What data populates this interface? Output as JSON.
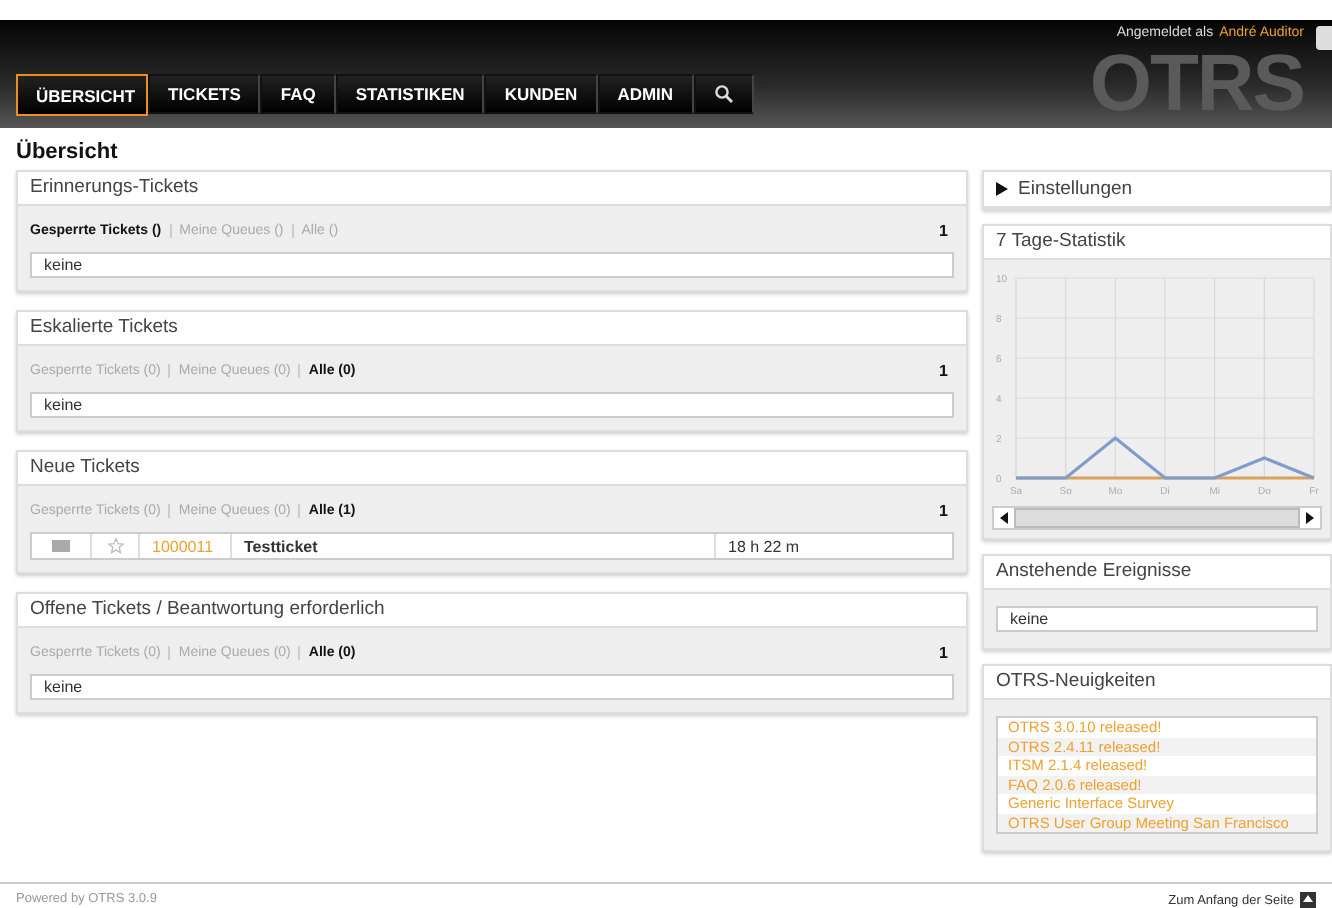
{
  "header": {
    "logo": "OTRS",
    "login_label": "Angemeldet als",
    "user": "André Auditor"
  },
  "nav": [
    {
      "label": "ÜBERSICHT",
      "selected": true
    },
    {
      "label": "TICKETS",
      "selected": false
    },
    {
      "label": "FAQ",
      "selected": false
    },
    {
      "label": "STATISTIKEN",
      "selected": false
    },
    {
      "label": "KUNDEN",
      "selected": false
    },
    {
      "label": "ADMIN",
      "selected": false
    }
  ],
  "page_title": "Übersicht",
  "widgets": [
    {
      "title": "Erinnerungs-Tickets",
      "filters": [
        {
          "label": "Gesperrte Tickets ()",
          "selected": true
        },
        {
          "label": "Meine Queues ()",
          "selected": false
        },
        {
          "label": "Alle ()",
          "selected": false
        }
      ],
      "page": "1",
      "empty": "keine"
    },
    {
      "title": "Eskalierte Tickets",
      "filters": [
        {
          "label": "Gesperrte Tickets (0)",
          "selected": false
        },
        {
          "label": "Meine Queues (0)",
          "selected": false
        },
        {
          "label": "Alle (0)",
          "selected": true
        }
      ],
      "page": "1",
      "empty": "keine"
    },
    {
      "title": "Neue Tickets",
      "filters": [
        {
          "label": "Gesperrte Tickets (0)",
          "selected": false
        },
        {
          "label": "Meine Queues (0)",
          "selected": false
        },
        {
          "label": "Alle (1)",
          "selected": true
        }
      ],
      "page": "1",
      "rows": [
        {
          "number": "1000011",
          "title": "Testticket",
          "age": "18 h 22 m"
        }
      ]
    },
    {
      "title": "Offene Tickets / Beantwortung erforderlich",
      "filters": [
        {
          "label": "Gesperrte Tickets (0)",
          "selected": false
        },
        {
          "label": "Meine Queues (0)",
          "selected": false
        },
        {
          "label": "Alle (0)",
          "selected": true
        }
      ],
      "page": "1",
      "empty": "keine"
    }
  ],
  "settings": {
    "title": "Einstellungen",
    "expanded": false
  },
  "stats": {
    "title": "7 Tage-Statistik",
    "chart_data": {
      "type": "line",
      "categories": [
        "Sa",
        "So",
        "Mo",
        "Di",
        "Mi",
        "Do",
        "Fr"
      ],
      "ylim": [
        0,
        10
      ],
      "grid": true,
      "yticks": [
        0,
        2,
        4,
        6,
        8,
        10
      ],
      "series": [
        {
          "color": "#d9a25a",
          "values": [
            0,
            0,
            0,
            0,
            0,
            0,
            0
          ]
        },
        {
          "color": "#7e9ccc",
          "values": [
            0,
            0,
            2,
            0,
            0,
            1,
            0
          ]
        }
      ]
    }
  },
  "events": {
    "title": "Anstehende Ereignisse",
    "empty": "keine"
  },
  "news": {
    "title": "OTRS-Neuigkeiten",
    "items": [
      "OTRS 3.0.10 released!",
      "OTRS 2.4.11 released!",
      "ITSM 2.1.4 released!",
      "FAQ 2.0.6 released!",
      "Generic Interface Survey",
      "OTRS User Group Meeting San Francisco"
    ]
  },
  "footer": {
    "powered": "Powered by OTRS 3.0.9",
    "top_link": "Zum Anfang der Seite"
  }
}
